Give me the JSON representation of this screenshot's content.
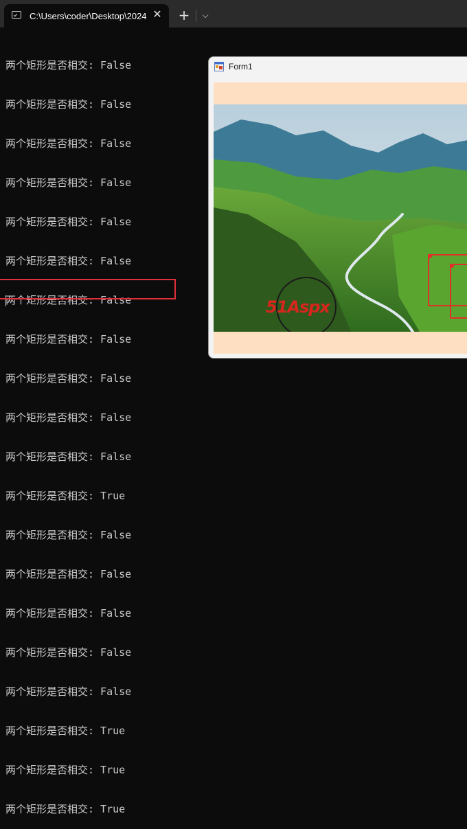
{
  "terminal": {
    "tab_title": "C:\\Users\\coder\\Desktop\\2024",
    "close_glyph": "✕",
    "new_tab_glyph": "+",
    "dropdown_glyph": "⌵"
  },
  "output": {
    "lines": [
      "两个矩形是否相交: False",
      "两个矩形是否相交: False",
      "两个矩形是否相交: False",
      "两个矩形是否相交: False",
      "两个矩形是否相交: False",
      "两个矩形是否相交: False",
      "两个矩形是否相交: False",
      "两个矩形是否相交: False",
      "两个矩形是否相交: False",
      "两个矩形是否相交: False",
      "两个矩形是否相交: False",
      "两个矩形是否相交: True",
      "两个矩形是否相交: False",
      "两个矩形是否相交: False",
      "两个矩形是否相交: False",
      "两个矩形是否相交: False",
      "两个矩形是否相交: False",
      "两个矩形是否相交: True",
      "两个矩形是否相交: True",
      "两个矩形是否相交: True"
    ]
  },
  "form": {
    "title": "Form1",
    "watermark_text": "51Aspx",
    "client_color": "#ffdfc2",
    "rect_color": "#e0302a"
  },
  "colors": {
    "terminal_bg": "#0c0c0c",
    "titlebar_bg": "#2b2b2b",
    "text": "#cccccc",
    "highlight": "#e0303a"
  }
}
